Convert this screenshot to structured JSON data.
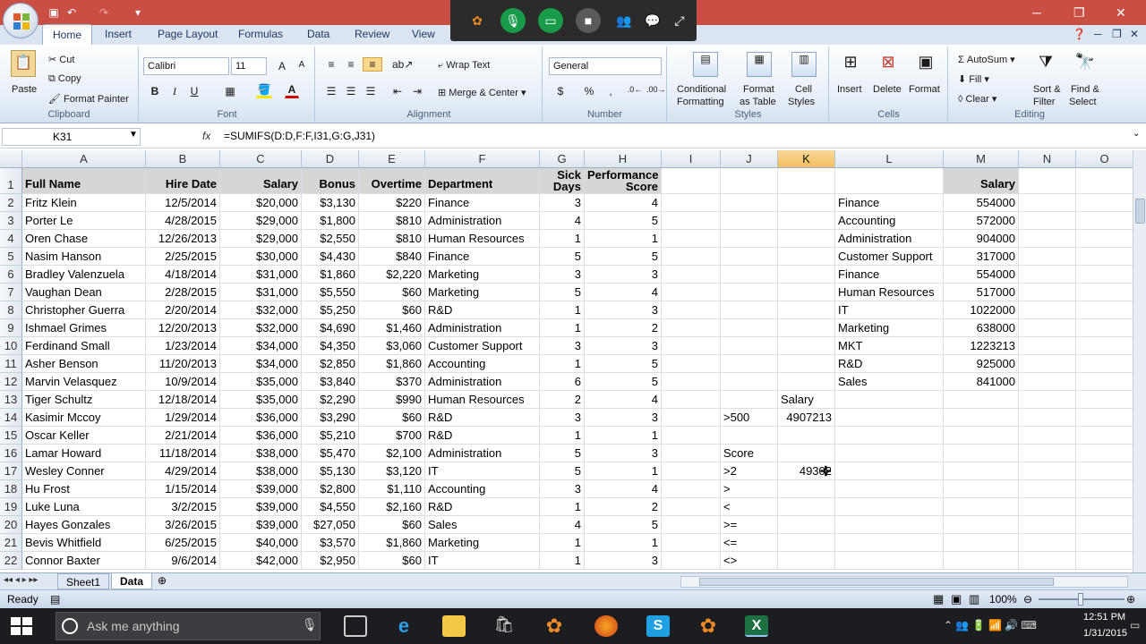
{
  "window": {
    "minimize": "─",
    "maximize": "❐",
    "close": "✕"
  },
  "tabs": [
    "Home",
    "Insert",
    "Page Layout",
    "Formulas",
    "Data",
    "Review",
    "View"
  ],
  "ribbon": {
    "clipboard": {
      "label": "Clipboard",
      "paste": "Paste",
      "cut": "Cut",
      "copy": "Copy",
      "format_painter": "Format Painter"
    },
    "font": {
      "label": "Font",
      "name": "Calibri",
      "size": "11",
      "bold": "B",
      "italic": "I",
      "underline": "U"
    },
    "alignment": {
      "label": "Alignment",
      "wrap": "Wrap Text",
      "merge": "Merge & Center"
    },
    "number": {
      "label": "Number",
      "format": "General",
      "currency": "$",
      "percent": "%",
      "comma": ","
    },
    "styles": {
      "label": "Styles",
      "conditional": "Conditional",
      "conditional2": "Formatting",
      "format_table": "Format",
      "format_table2": "as Table",
      "cell_styles": "Cell",
      "cell_styles2": "Styles"
    },
    "cells": {
      "label": "Cells",
      "insert": "Insert",
      "delete": "Delete",
      "format": "Format"
    },
    "editing": {
      "label": "Editing",
      "autosum": "AutoSum",
      "fill": "Fill",
      "clear": "Clear",
      "sort": "Sort &",
      "sort2": "Filter",
      "find": "Find &",
      "find2": "Select"
    }
  },
  "formula_bar": {
    "name_box": "K31",
    "fx": "fx",
    "formula": "=SUMIFS(D:D,F:F,I31,G:G,J31)"
  },
  "columns": [
    "A",
    "B",
    "C",
    "D",
    "E",
    "F",
    "G",
    "H",
    "I",
    "J",
    "K",
    "L",
    "M",
    "N",
    "O"
  ],
  "selected_column": "K",
  "rows": [
    "1",
    "2",
    "3",
    "4",
    "5",
    "6",
    "7",
    "8",
    "9",
    "10",
    "11",
    "12",
    "13",
    "14",
    "15",
    "16",
    "17",
    "18",
    "19",
    "20",
    "21",
    "22"
  ],
  "header": {
    "a": "Full Name",
    "b": "Hire Date",
    "c": "Salary",
    "d": "Bonus",
    "e": "Overtime",
    "f": "Department",
    "g": "Sick Days",
    "h": "Performance Score",
    "m": "Salary"
  },
  "data": [
    [
      "Fritz Klein",
      "12/5/2014",
      "$20,000",
      "$3,130",
      "$220",
      "Finance",
      "3",
      "4"
    ],
    [
      "Porter Le",
      "4/28/2015",
      "$29,000",
      "$1,800",
      "$810",
      "Administration",
      "4",
      "5"
    ],
    [
      "Oren Chase",
      "12/26/2013",
      "$29,000",
      "$2,550",
      "$810",
      "Human Resources",
      "1",
      "1"
    ],
    [
      "Nasim Hanson",
      "2/25/2015",
      "$30,000",
      "$4,430",
      "$840",
      "Finance",
      "5",
      "5"
    ],
    [
      "Bradley Valenzuela",
      "4/18/2014",
      "$31,000",
      "$1,860",
      "$2,220",
      "Marketing",
      "3",
      "3"
    ],
    [
      "Vaughan Dean",
      "2/28/2015",
      "$31,000",
      "$5,550",
      "$60",
      "Marketing",
      "5",
      "4"
    ],
    [
      "Christopher Guerra",
      "2/20/2014",
      "$32,000",
      "$5,250",
      "$60",
      "R&D",
      "1",
      "3"
    ],
    [
      "Ishmael Grimes",
      "12/20/2013",
      "$32,000",
      "$4,690",
      "$1,460",
      "Administration",
      "1",
      "2"
    ],
    [
      "Ferdinand Small",
      "1/23/2014",
      "$34,000",
      "$4,350",
      "$3,060",
      "Customer Support",
      "3",
      "3"
    ],
    [
      "Asher Benson",
      "11/20/2013",
      "$34,000",
      "$2,850",
      "$1,860",
      "Accounting",
      "1",
      "5"
    ],
    [
      "Marvin Velasquez",
      "10/9/2014",
      "$35,000",
      "$3,840",
      "$370",
      "Administration",
      "6",
      "5"
    ],
    [
      "Tiger Schultz",
      "12/18/2014",
      "$35,000",
      "$2,290",
      "$990",
      "Human Resources",
      "2",
      "4"
    ],
    [
      "Kasimir Mccoy",
      "1/29/2014",
      "$36,000",
      "$3,290",
      "$60",
      "R&D",
      "3",
      "3"
    ],
    [
      "Oscar Keller",
      "2/21/2014",
      "$36,000",
      "$5,210",
      "$700",
      "R&D",
      "1",
      "1"
    ],
    [
      "Lamar Howard",
      "11/18/2014",
      "$38,000",
      "$5,470",
      "$2,100",
      "Administration",
      "5",
      "3"
    ],
    [
      "Wesley Conner",
      "4/29/2014",
      "$38,000",
      "$5,130",
      "$3,120",
      "IT",
      "5",
      "1"
    ],
    [
      "Hu Frost",
      "1/15/2014",
      "$39,000",
      "$2,800",
      "$1,110",
      "Accounting",
      "3",
      "4"
    ],
    [
      "Luke Luna",
      "3/2/2015",
      "$39,000",
      "$4,550",
      "$2,160",
      "R&D",
      "1",
      "2"
    ],
    [
      "Hayes Gonzales",
      "3/26/2015",
      "$39,000",
      "$27,050",
      "$60",
      "Sales",
      "4",
      "5"
    ],
    [
      "Bevis Whitfield",
      "6/25/2015",
      "$40,000",
      "$3,570",
      "$1,860",
      "Marketing",
      "1",
      "1"
    ],
    [
      "Connor Baxter",
      "9/6/2014",
      "$42,000",
      "$2,950",
      "$60",
      "IT",
      "1",
      "3"
    ]
  ],
  "summary": [
    [
      "Finance",
      "554000"
    ],
    [
      "Accounting",
      "572000"
    ],
    [
      "Administration",
      "904000"
    ],
    [
      "Customer Support",
      "317000"
    ],
    [
      "Finance",
      "554000"
    ],
    [
      "Human Resources",
      "517000"
    ],
    [
      "IT",
      "1022000"
    ],
    [
      "Marketing",
      "638000"
    ],
    [
      "MKT",
      "1223213"
    ],
    [
      "R&D",
      "925000"
    ],
    [
      "Sales",
      "841000"
    ]
  ],
  "criteria": {
    "k13": "Salary",
    "j14": ">500",
    "k14": "4907213",
    "j16": "Score",
    "j17": ">2",
    "k17": "49302",
    "j18": ">",
    "j19": "<",
    "j20": ">=",
    "j21": "<=",
    "j22": "<>"
  },
  "sheets": [
    "Sheet1",
    "Data"
  ],
  "active_sheet": "Data",
  "status": {
    "ready": "Ready",
    "zoom": "100%"
  },
  "taskbar": {
    "search": "Ask me anything",
    "time": "12:51 PM",
    "date": "1/31/2015"
  }
}
